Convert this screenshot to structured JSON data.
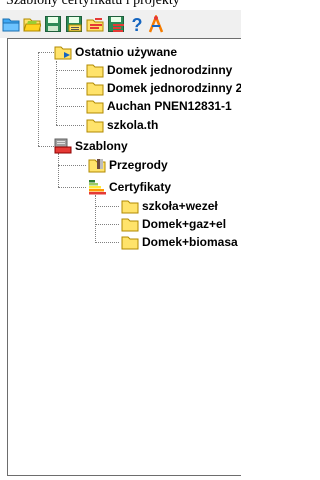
{
  "window": {
    "title_fragment": "Szablony certyfikatu i projekty"
  },
  "toolbar": {
    "buttons": [
      {
        "icon": "open-folder-blue-icon"
      },
      {
        "icon": "open-folder-icon"
      },
      {
        "icon": "save-icon"
      },
      {
        "icon": "save-as-icon"
      },
      {
        "icon": "folder-chart-icon"
      },
      {
        "icon": "save-chart-icon"
      },
      {
        "icon": "help-icon"
      },
      {
        "icon": "tools-icon"
      }
    ]
  },
  "tree": {
    "recent": {
      "label": "Ostatnio używane",
      "icon": "recent-folder-icon",
      "items": [
        {
          "label": "Domek jednorodzinny",
          "icon": "folder-icon"
        },
        {
          "label": "Domek jednorodzinny 2",
          "icon": "folder-icon"
        },
        {
          "label": "Auchan PNEN12831-1",
          "icon": "folder-icon"
        },
        {
          "label": "szkola.th",
          "icon": "folder-icon"
        }
      ]
    },
    "templates": {
      "label": "Szablony",
      "icon": "templates-icon",
      "partitions": {
        "label": "Przegrody",
        "icon": "folder-partitions-icon"
      },
      "certificates": {
        "label": "Certyfikaty",
        "icon": "energy-class-icon",
        "items": [
          {
            "label": "szkoła+wezeł",
            "icon": "folder-icon"
          },
          {
            "label": "Domek+gaz+el",
            "icon": "folder-icon"
          },
          {
            "label": "Domek+biomasa",
            "icon": "folder-icon"
          }
        ]
      }
    }
  },
  "colors": {
    "folder_yellow": "#ffe36b",
    "toolbar_bg": "#f0f0f0",
    "border": "#6d6d6d"
  }
}
